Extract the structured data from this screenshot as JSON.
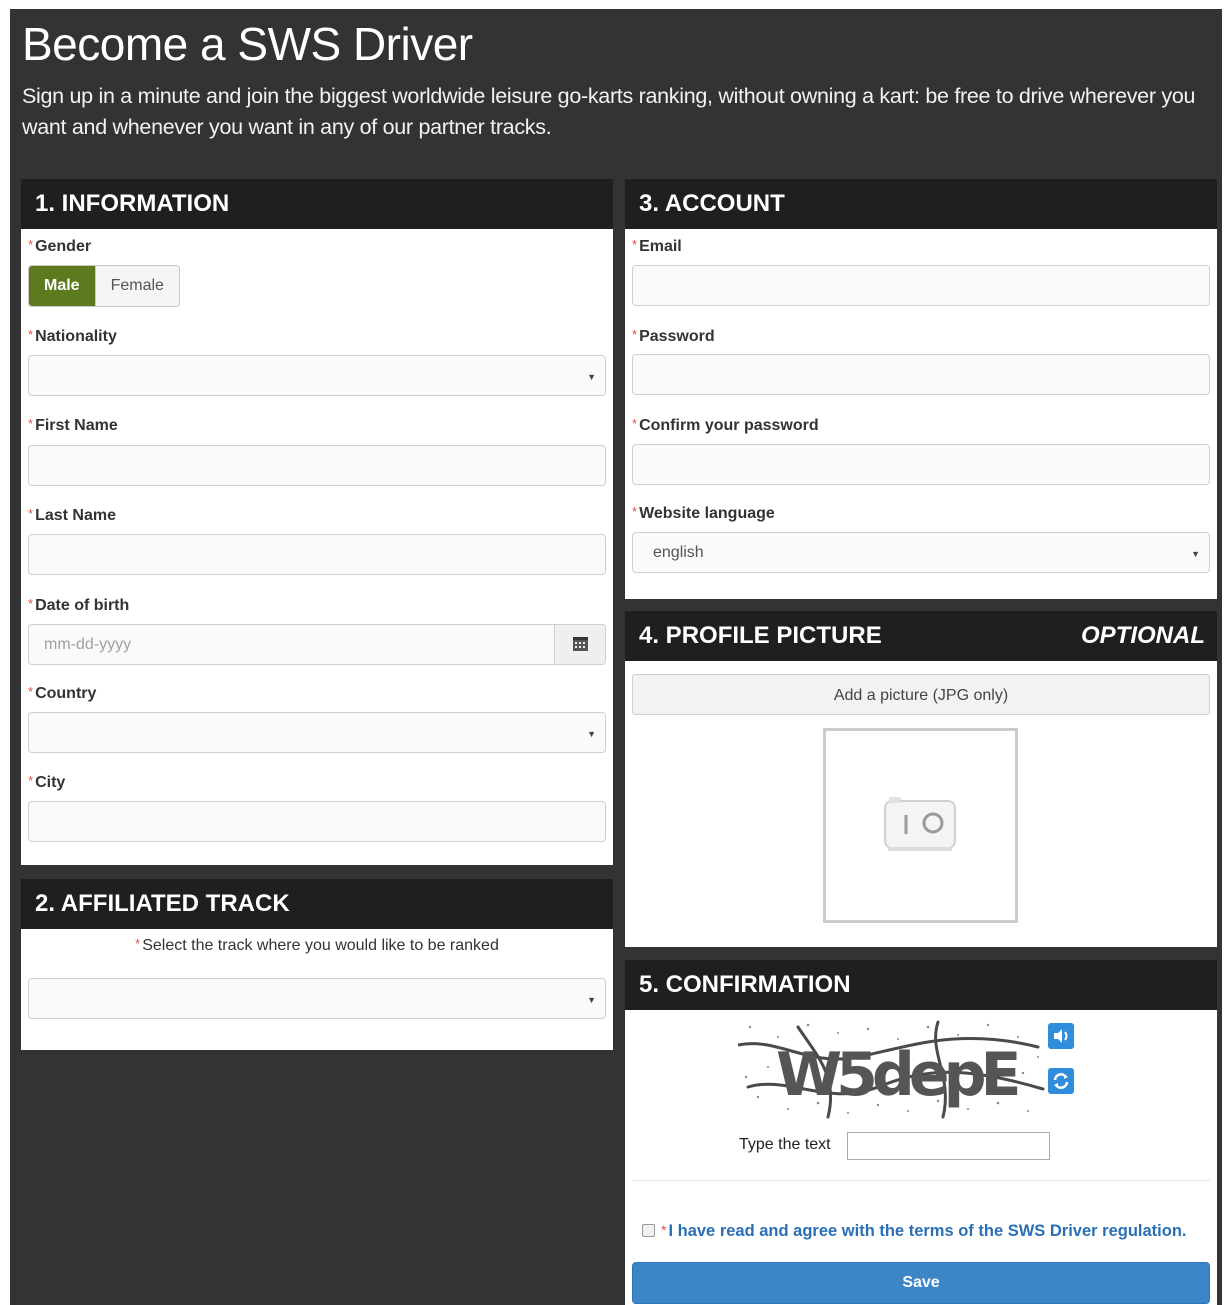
{
  "header": {
    "title": "Become a SWS Driver",
    "subtitle": "Sign up in a minute and join the biggest worldwide leisure go-karts ranking, without owning a kart: be free to drive wherever you want and whenever you want in any of our partner tracks."
  },
  "required_marker": "*",
  "information": {
    "heading": "1. INFORMATION",
    "gender_label": "Gender",
    "gender_options": [
      "Male",
      "Female"
    ],
    "gender_selected": "Male",
    "nationality_label": "Nationality",
    "nationality_value": "",
    "first_name_label": "First Name",
    "first_name_value": "",
    "last_name_label": "Last Name",
    "last_name_value": "",
    "dob_label": "Date of birth",
    "dob_placeholder": "mm-dd-yyyy",
    "country_label": "Country",
    "country_value": "",
    "city_label": "City",
    "city_value": ""
  },
  "affiliated_track": {
    "heading": "2. AFFILIATED TRACK",
    "prompt": "Select the track where you would like to be ranked",
    "track_value": ""
  },
  "account": {
    "heading": "3. ACCOUNT",
    "email_label": "Email",
    "password_label": "Password",
    "confirm_password_label": "Confirm your password",
    "language_label": "Website language",
    "language_value": "english"
  },
  "profile_picture": {
    "heading": "4. PROFILE PICTURE",
    "optional_tag": "OPTIONAL",
    "add_button": "Add a picture (JPG only)"
  },
  "confirmation": {
    "heading": "5. CONFIRMATION",
    "captcha_text": "W5depE",
    "type_text_label": "Type the text",
    "captcha_value": "",
    "terms_text": "I have read and agree with the terms of the SWS Driver regulation.",
    "save_label": "Save"
  },
  "colors": {
    "page_bg": "#333333",
    "header_bar": "#1f1f1f",
    "gender_selected": "#5d7a1f",
    "save_button": "#3c86c8",
    "link": "#2a6fb5",
    "required": "#d9534f"
  }
}
